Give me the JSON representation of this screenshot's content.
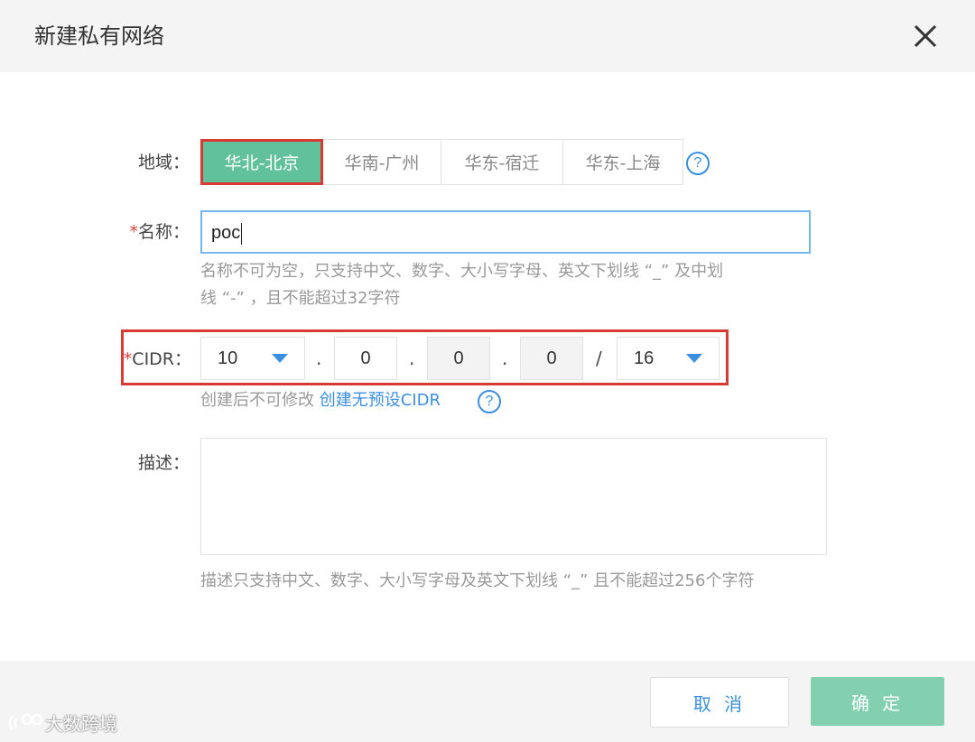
{
  "dialog": {
    "title": "新建私有网络"
  },
  "region": {
    "label": "地域：",
    "options": [
      "华北-北京",
      "华南-广州",
      "华东-宿迁",
      "华东-上海"
    ],
    "selected": "华北-北京"
  },
  "name": {
    "required_mark": "*",
    "label": "名称：",
    "value": "poc",
    "hint_line1": "名称不可为空，只支持中文、数字、大小写字母、英文下划线 “_” 及中划",
    "hint_line2": "线 “-” ，且不能超过32字符"
  },
  "cidr": {
    "required_mark": "*",
    "label": "CIDR：",
    "octet1": "10",
    "octet2": "0",
    "octet3": "0",
    "octet4": "0",
    "dot": ".",
    "slash": "/",
    "mask": "16",
    "hint": "创建后不可修改",
    "link": "创建无预设CIDR"
  },
  "description": {
    "label": "描述：",
    "value": "",
    "hint": "描述只支持中文、数字、大小写字母及英文下划线 “_” 且不能超过256个字符"
  },
  "footer": {
    "cancel_label": "取 消",
    "confirm_label": "确 定"
  },
  "watermark": {
    "text": "大数跨境"
  },
  "icons": {
    "help": "?",
    "close": "close-icon",
    "dropdown": "triangle-down-icon"
  },
  "colors": {
    "primary": "#61c19a",
    "link": "#3b8fe0",
    "highlight": "#d93a33"
  }
}
